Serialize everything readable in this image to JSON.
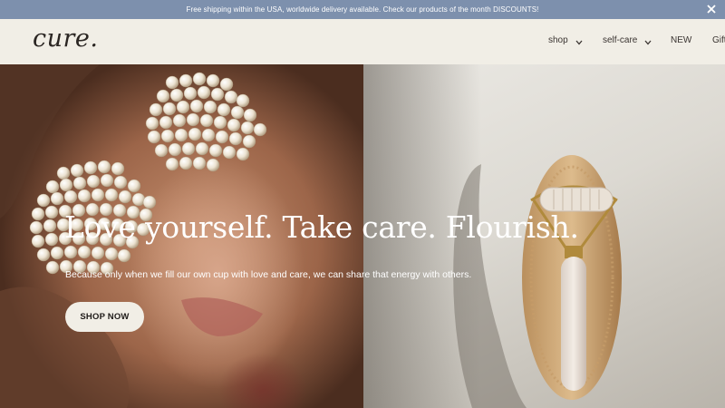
{
  "announcement": {
    "text": "Free shipping within the USA, worldwide delivery available. Check our products of the month DISCOUNTS!"
  },
  "header": {
    "logo": "cure.",
    "nav": [
      {
        "label": "shop",
        "has_dropdown": true
      },
      {
        "label": "self-care",
        "has_dropdown": true
      },
      {
        "label": "NEW",
        "has_dropdown": false
      },
      {
        "label": "Gift",
        "has_dropdown": false
      }
    ]
  },
  "hero": {
    "headline": "Love yourself. Take care. Flourish.",
    "subline": "Because only when we fill our own cup with love and care, we can share that energy with others.",
    "cta_label": "SHOP NOW"
  },
  "icons": {
    "close": "close-icon",
    "chevron": "chevron-down-icon"
  },
  "colors": {
    "announcement_bg": "#7d90ad",
    "header_bg": "#f1eee6",
    "button_bg": "#f1eee6",
    "text_dark": "#2a2522"
  }
}
